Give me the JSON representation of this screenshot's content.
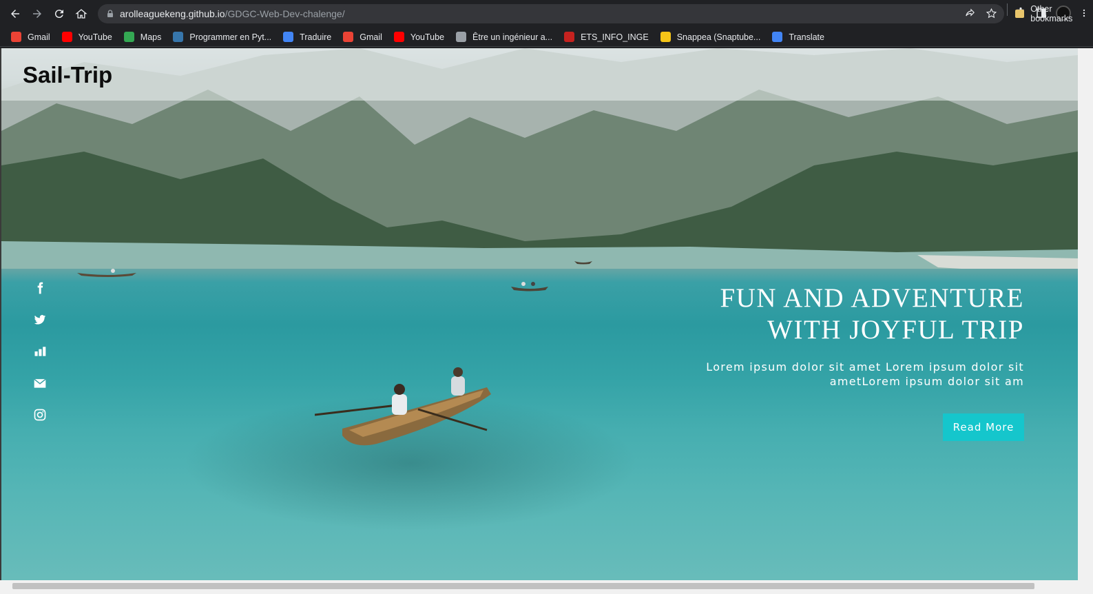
{
  "browser": {
    "url_host": "arolleaguekeng.github.io",
    "url_path": "/GDGC-Web-Dev-chalenge/",
    "bookmarks": [
      {
        "label": "Gmail",
        "icon": "gmail-icon",
        "color": "#ea4335"
      },
      {
        "label": "YouTube",
        "icon": "youtube-icon",
        "color": "#ff0000"
      },
      {
        "label": "Maps",
        "icon": "maps-icon",
        "color": "#34a853"
      },
      {
        "label": "Programmer en Pyt...",
        "icon": "python-icon",
        "color": "#3776ab"
      },
      {
        "label": "Traduire",
        "icon": "translate-icon",
        "color": "#4285f4"
      },
      {
        "label": "Gmail",
        "icon": "gmail-icon",
        "color": "#ea4335"
      },
      {
        "label": "YouTube",
        "icon": "youtube-icon",
        "color": "#ff0000"
      },
      {
        "label": "Être un ingénieur a...",
        "icon": "wordpress-icon",
        "color": "#9aa0a6"
      },
      {
        "label": "ETS_INFO_INGE",
        "icon": "gmail-icon",
        "color": "#c5221f"
      },
      {
        "label": "Snappea (Snaptube...",
        "icon": "snappea-icon",
        "color": "#f5c518"
      },
      {
        "label": "Translate",
        "icon": "translate-icon",
        "color": "#4285f4"
      }
    ],
    "other_bookmarks": "Other bookmarks"
  },
  "page": {
    "logo": "Sail-Trip",
    "headline_line1": "FUN AND ADVENTURE",
    "headline_line2": "WITH JOYFUL TRIP",
    "subtext_line1": "Lorem ipsum dolor sit amet Lorem ipsum dolor sit",
    "subtext_line2": "ametLorem ipsum dolor sit am",
    "button_label": "Read More",
    "accent_color": "#15c6cc",
    "social_icons": [
      "facebook-icon",
      "twitter-icon",
      "stats-icon",
      "mail-icon",
      "instagram-icon"
    ]
  }
}
